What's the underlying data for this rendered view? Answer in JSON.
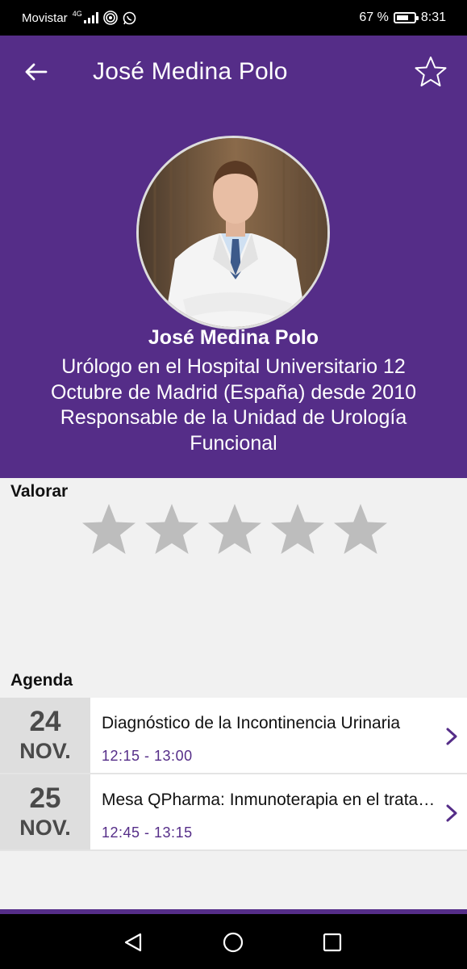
{
  "status_bar": {
    "carrier": "Movistar",
    "network": "4G",
    "battery": "67 %",
    "time": "8:31"
  },
  "app_bar": {
    "title": "José Medina Polo",
    "back_icon": "arrow-left-icon",
    "favorite_icon": "star-outline-icon"
  },
  "speaker": {
    "name": "José Medina Polo",
    "bio": "Urólogo en el Hospital Universitario 12 Octubre de Madrid (España) desde 2010 Responsable de la Unidad de Urología Funcional"
  },
  "rating": {
    "title": "Valorar",
    "value": 0,
    "max": 5
  },
  "agenda": {
    "title": "Agenda",
    "items": [
      {
        "day": "24",
        "month": "NOV.",
        "title": "Diagnóstico de la Incontinencia Urinaria",
        "time": "12:15 - 13:00"
      },
      {
        "day": "25",
        "month": "NOV.",
        "title": "Mesa QPharma: Inmunoterapia en el tratamiento",
        "time": "12:45 - 13:15"
      }
    ]
  },
  "colors": {
    "primary": "#552d88",
    "star_inactive": "#bdbdbd",
    "date_bg": "#dedede"
  }
}
